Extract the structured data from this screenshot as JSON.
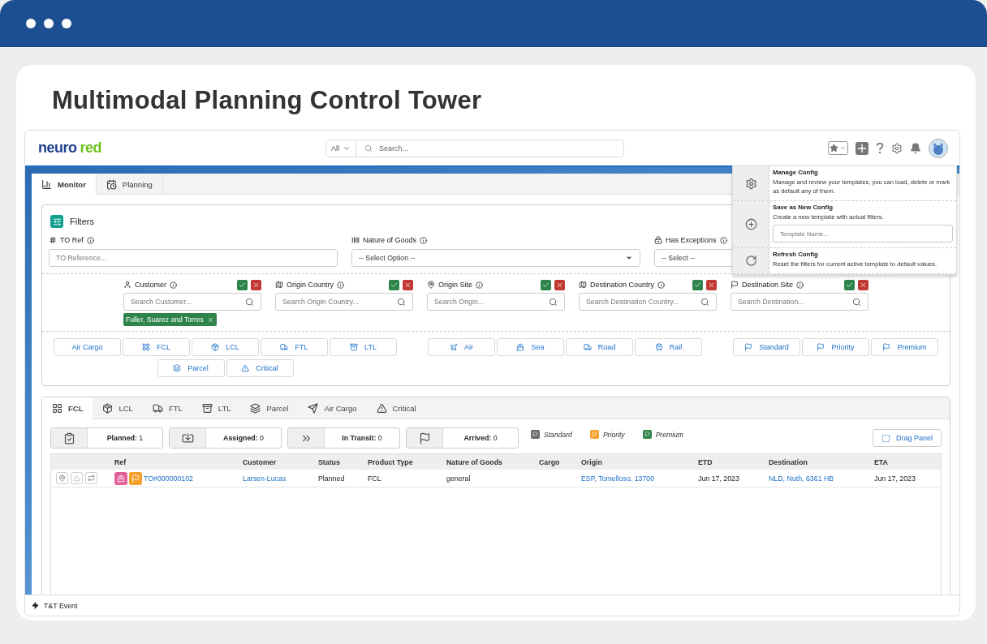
{
  "page_title": "Multimodal Planning Control Tower",
  "header": {
    "logo": {
      "first": "neuro",
      "second": "red"
    },
    "search_scope": "All",
    "search_placeholder": "Search..."
  },
  "main_tabs": [
    {
      "label": "Monitor",
      "kind": "chart",
      "selected": true
    },
    {
      "label": "Planning",
      "kind": "calendar",
      "selected": false
    }
  ],
  "config_menu": [
    {
      "kind": "manage",
      "title": "Manage Config",
      "description": "Manage and review your templates, you can load, delete or mark as default any of them."
    },
    {
      "kind": "save",
      "title": "Save as New Config",
      "description": "Create a new template with actual filters.",
      "placeholder": "Template Name..."
    },
    {
      "kind": "refresh",
      "title": "Refresh Config",
      "description": "Reset the filters for current active template to default values."
    }
  ],
  "filters": {
    "title": "Filters",
    "top_fields": [
      {
        "kind": "text",
        "label": "TO Ref",
        "placeholder": "TO Reference..."
      },
      {
        "kind": "select",
        "label": "Nature of Goods",
        "value": "-- Select Option --"
      },
      {
        "kind": "select",
        "label": "Has Exceptions",
        "value": "-- Select --"
      }
    ],
    "search_fields": [
      {
        "label": "Customer",
        "placeholder": "Search Customer...",
        "chips": [
          "Fuller, Suarez and Torres"
        ]
      },
      {
        "label": "Origin Country",
        "placeholder": "Search Origin Country..."
      },
      {
        "label": "Origin Site",
        "placeholder": "Search Origin..."
      },
      {
        "label": "Destination Country",
        "placeholder": "Search Destination Country..."
      },
      {
        "label": "Destination Site",
        "placeholder": "Search Destination..."
      }
    ],
    "button_groups": [
      [
        {
          "label": "Air Cargo",
          "kind": "plain"
        },
        {
          "label": "FCL",
          "kind": "grid"
        },
        {
          "label": "LCL",
          "kind": "package"
        },
        {
          "label": "FTL",
          "kind": "truck"
        },
        {
          "label": "LTL",
          "kind": "archive"
        },
        {
          "label": "Parcel",
          "kind": "layers"
        },
        {
          "label": "Critical",
          "kind": "warning"
        }
      ],
      [
        {
          "label": "Air",
          "kind": "plane"
        },
        {
          "label": "Sea",
          "kind": "ship"
        },
        {
          "label": "Road",
          "kind": "truck"
        },
        {
          "label": "Rail",
          "kind": "train"
        }
      ],
      [
        {
          "label": "Standard",
          "kind": "flag"
        },
        {
          "label": "Priority",
          "kind": "flag"
        },
        {
          "label": "Premium",
          "kind": "flag"
        }
      ]
    ]
  },
  "result_tabs": [
    {
      "label": "FCL",
      "kind": "grid",
      "selected": true
    },
    {
      "label": "LCL",
      "kind": "package",
      "selected": false
    },
    {
      "label": "FTL",
      "kind": "truck",
      "selected": false
    },
    {
      "label": "LTL",
      "kind": "archive",
      "selected": false
    },
    {
      "label": "Parcel",
      "kind": "layers",
      "selected": false
    },
    {
      "label": "Air Cargo",
      "kind": "send",
      "selected": false
    },
    {
      "label": "Critical",
      "kind": "warning",
      "selected": false
    }
  ],
  "status_cards": [
    {
      "kind": "planned",
      "label": "Planned:",
      "value": "1"
    },
    {
      "kind": "assigned",
      "label": "Assigned:",
      "value": "0"
    },
    {
      "kind": "transit",
      "label": "In Transit:",
      "value": "0"
    },
    {
      "kind": "arrived",
      "label": "Arrived:",
      "value": "0"
    }
  ],
  "legend": [
    {
      "label": "Standard",
      "color": "#6b6b6b"
    },
    {
      "label": "Priority",
      "color": "#f4a12c"
    },
    {
      "label": "Premium",
      "color": "#2e844a"
    }
  ],
  "drag_button": "Drag Panel",
  "table": {
    "columns": [
      "Ref",
      "Customer",
      "Status",
      "Product Type",
      "Nature of Goods",
      "Cargo",
      "Origin",
      "ETD",
      "Destination",
      "ETA"
    ],
    "rows": [
      {
        "badges": [
          {
            "kind": "ship",
            "color": "#e3619b"
          },
          {
            "kind": "flag",
            "color": "#f4a12c"
          }
        ],
        "ref": "TO#000000102",
        "customer": "Larsen-Lucas",
        "status": "Planned",
        "product_type": "FCL",
        "nature": "general",
        "origin": "ESP, Tomelloso, 13700",
        "etd": "Jun 17, 2023",
        "destination": "NLD, Nuth, 6361 HB",
        "eta": "Jun 17, 2023"
      }
    ]
  },
  "footer": {
    "label": "T&T Event"
  }
}
